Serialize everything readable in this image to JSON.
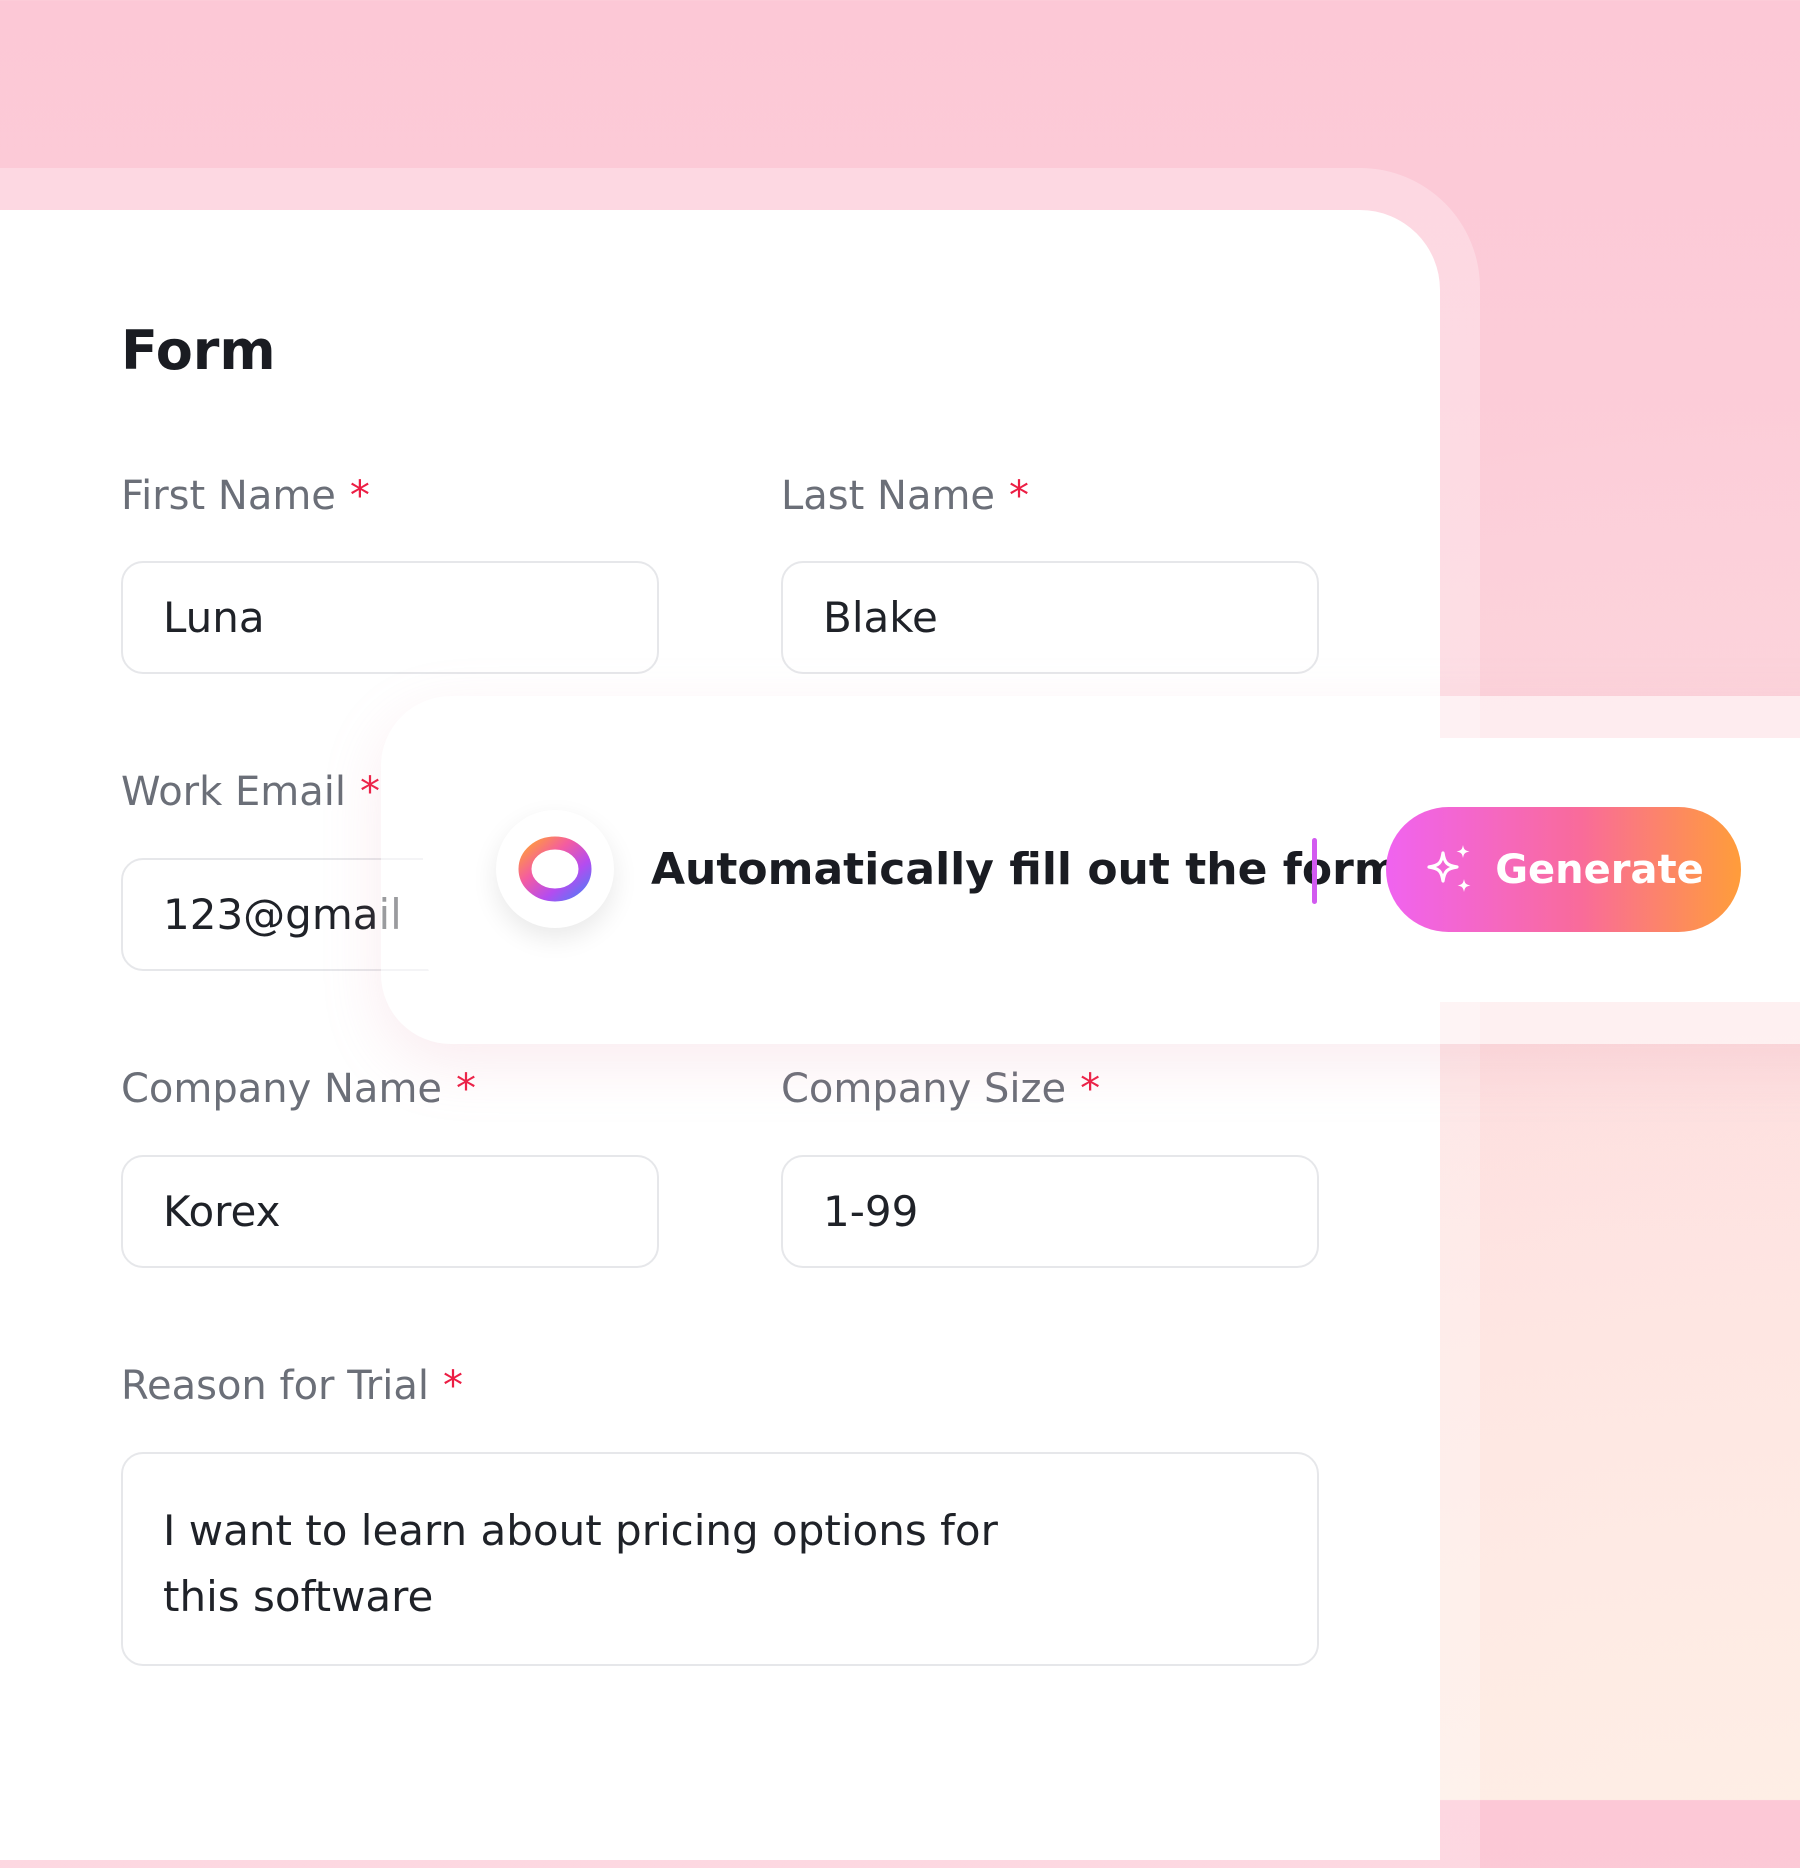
{
  "form": {
    "title": "Form",
    "required_marker": "*",
    "fields": {
      "first_name": {
        "label": "First Name",
        "value": "Luna"
      },
      "last_name": {
        "label": "Last Name",
        "value": "Blake"
      },
      "work_email": {
        "label": "Work Email",
        "value": "123@gmail"
      },
      "company_name": {
        "label": "Company Name",
        "value": "Korex"
      },
      "company_size": {
        "label": "Company Size",
        "value": "1-99"
      },
      "reason": {
        "label": "Reason for Trial",
        "value": "I want to learn about pricing options for this software"
      }
    }
  },
  "ai_assistant": {
    "logo_icon": "ai-ring-logo",
    "prompt": "Automatically fill out the form",
    "generate_label": "Generate",
    "generate_icon": "sparkles-icon",
    "colors": {
      "gradient_start": "#f063f0",
      "gradient_mid": "#f96b9a",
      "gradient_end": "#ff9d3a",
      "caret": "#d25af0"
    }
  },
  "colors": {
    "required": "#ec1e44",
    "label": "#6b6f78",
    "text": "#1f2228",
    "field_border": "#e6e7ea"
  }
}
